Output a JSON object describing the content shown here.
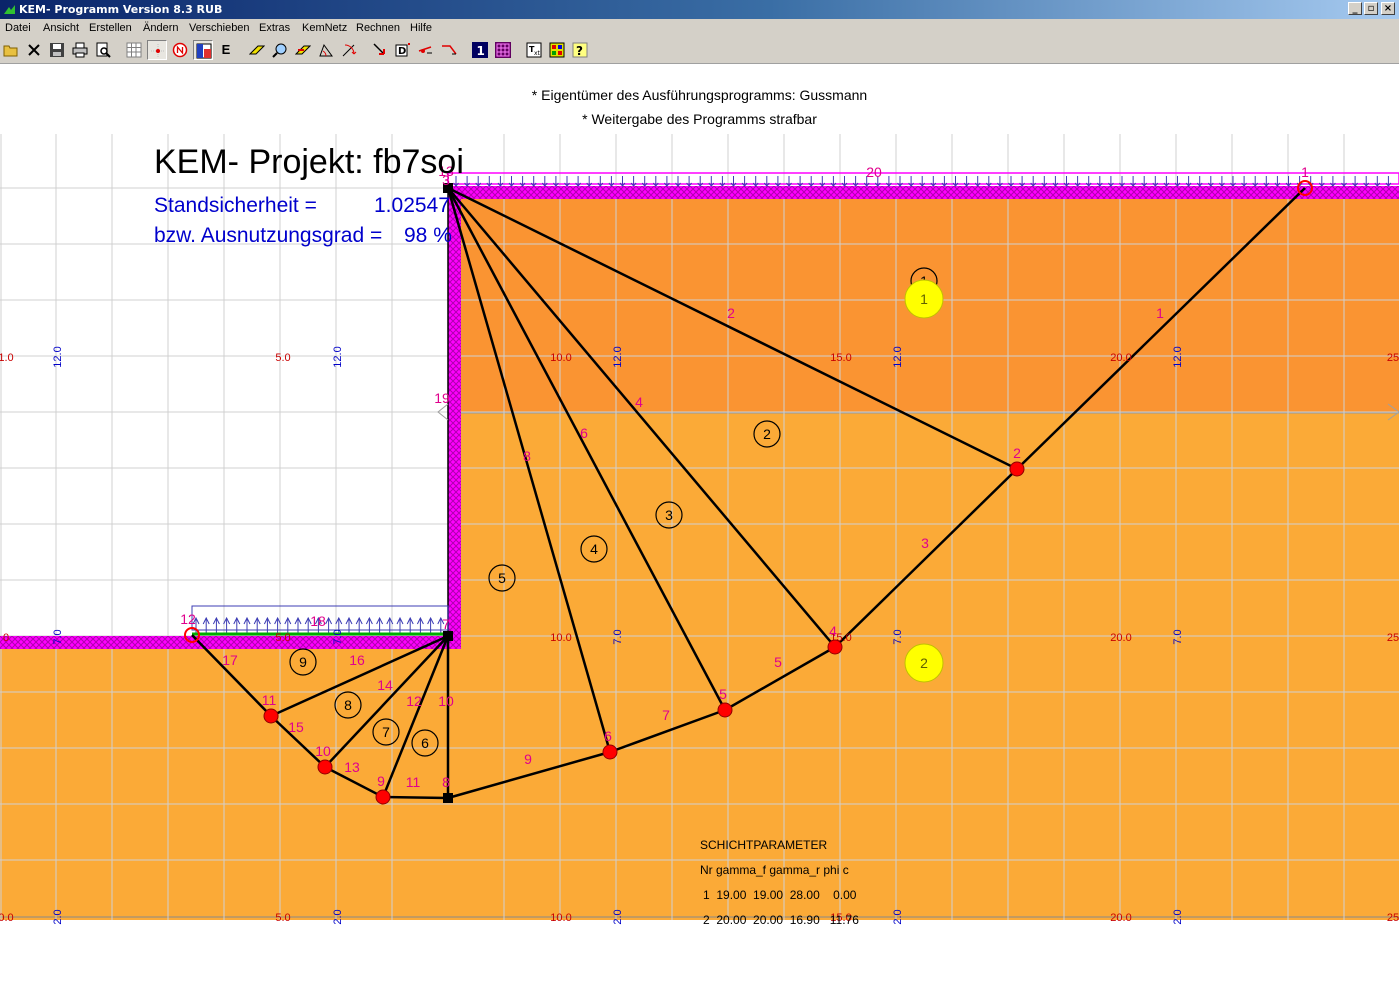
{
  "window": {
    "title": "KEM- Programm Version 8.3 RUB"
  },
  "menu": [
    "Datei",
    "Ansicht",
    "Erstellen",
    "Ändern",
    "Verschieben",
    "Extras",
    "KemNetz",
    "Rechnen",
    "Hilfe"
  ],
  "toolbar": {
    "icons": [
      "open-icon",
      "close-file-icon",
      "save-icon",
      "print-icon",
      "print-preview-icon",
      "grid-icon",
      "point-icon",
      "north-icon",
      "color-icon",
      "edit-e-icon",
      "draw-icon",
      "zoom-icon",
      "move-icon",
      "angle-icon",
      "rotate-icon",
      "node-arrow-icon",
      "dimension-icon",
      "line-arrow-icon",
      "link-icon",
      "number-one-icon",
      "matrix-icon",
      "text-icon",
      "palette-icon",
      "help-icon"
    ],
    "e_label": "E"
  },
  "notices": [
    "* Eigentümer des Ausführungsprogramms: Gussmann",
    "* Weitergabe des Programms strafbar"
  ],
  "project": {
    "title": "KEM- Projekt: fb7soi",
    "safety_label": "Standsicherheit =",
    "safety_value": "1.02547",
    "utilization_label": "bzw. Ausnutzungsgrad =",
    "utilization_value": "98 %"
  },
  "colors": {
    "soil_upper": "#fa9432",
    "soil_lower": "#fbaa37",
    "surface": "#ff00ff",
    "load": "#3c3cb4",
    "node": "#ff0000",
    "line_label": "#e0008c",
    "grid_red": "#c80000",
    "grid_blue": "#0000c8",
    "layer_marker": "#ffff00"
  },
  "grid": {
    "row1": [
      [
        "1.0",
        "red"
      ],
      [
        "12.0",
        "blue"
      ],
      [
        "5.0",
        "red"
      ],
      [
        "12.0",
        "blue"
      ],
      [
        "10.0",
        "red"
      ],
      [
        "12.0",
        "blue"
      ],
      [
        "15.0",
        "red"
      ],
      [
        "12.0",
        "blue"
      ],
      [
        "20.0",
        "red"
      ],
      [
        "12.0",
        "blue"
      ],
      [
        "25",
        "red"
      ]
    ],
    "row2": [
      [
        "0",
        "red"
      ],
      [
        "7.0",
        "blue"
      ],
      [
        "5.0",
        "red"
      ],
      [
        "7.0",
        "blue"
      ],
      [
        "10.0",
        "red"
      ],
      [
        "7.0",
        "blue"
      ],
      [
        "15.0",
        "red"
      ],
      [
        "7.0",
        "blue"
      ],
      [
        "20.0",
        "red"
      ],
      [
        "7.0",
        "blue"
      ],
      [
        "25",
        "red"
      ]
    ],
    "row3": [
      [
        "0.0",
        "red"
      ],
      [
        "2.0",
        "blue"
      ],
      [
        "5.0",
        "red"
      ],
      [
        "2.0",
        "blue"
      ],
      [
        "10.0",
        "red"
      ],
      [
        "2.0",
        "blue"
      ],
      [
        "15.0",
        "red"
      ],
      [
        "2.0",
        "blue"
      ],
      [
        "20.0",
        "red"
      ],
      [
        "2.0",
        "blue"
      ],
      [
        "25",
        "red"
      ]
    ]
  },
  "node_labels": [
    "1",
    "2",
    "3",
    "4",
    "5",
    "6",
    "7",
    "8",
    "9",
    "10",
    "11",
    "12",
    "13"
  ],
  "line_labels": [
    "1",
    "2",
    "3",
    "4",
    "5",
    "6",
    "7",
    "8",
    "9",
    "10",
    "11",
    "12",
    "13",
    "14",
    "15",
    "16",
    "17",
    "18",
    "19",
    "20"
  ],
  "block_labels": [
    "1",
    "2",
    "3",
    "4",
    "5",
    "6",
    "7",
    "8",
    "9"
  ],
  "layer_markers": [
    "1",
    "2"
  ],
  "schicht": {
    "title": "SCHICHTPARAMETER",
    "header": "Nr gamma_f gamma_r phi c",
    "rows": [
      "1  19.00  19.00  28.00    0.00",
      "2  20.00  20.00  16.90   11.76"
    ]
  }
}
